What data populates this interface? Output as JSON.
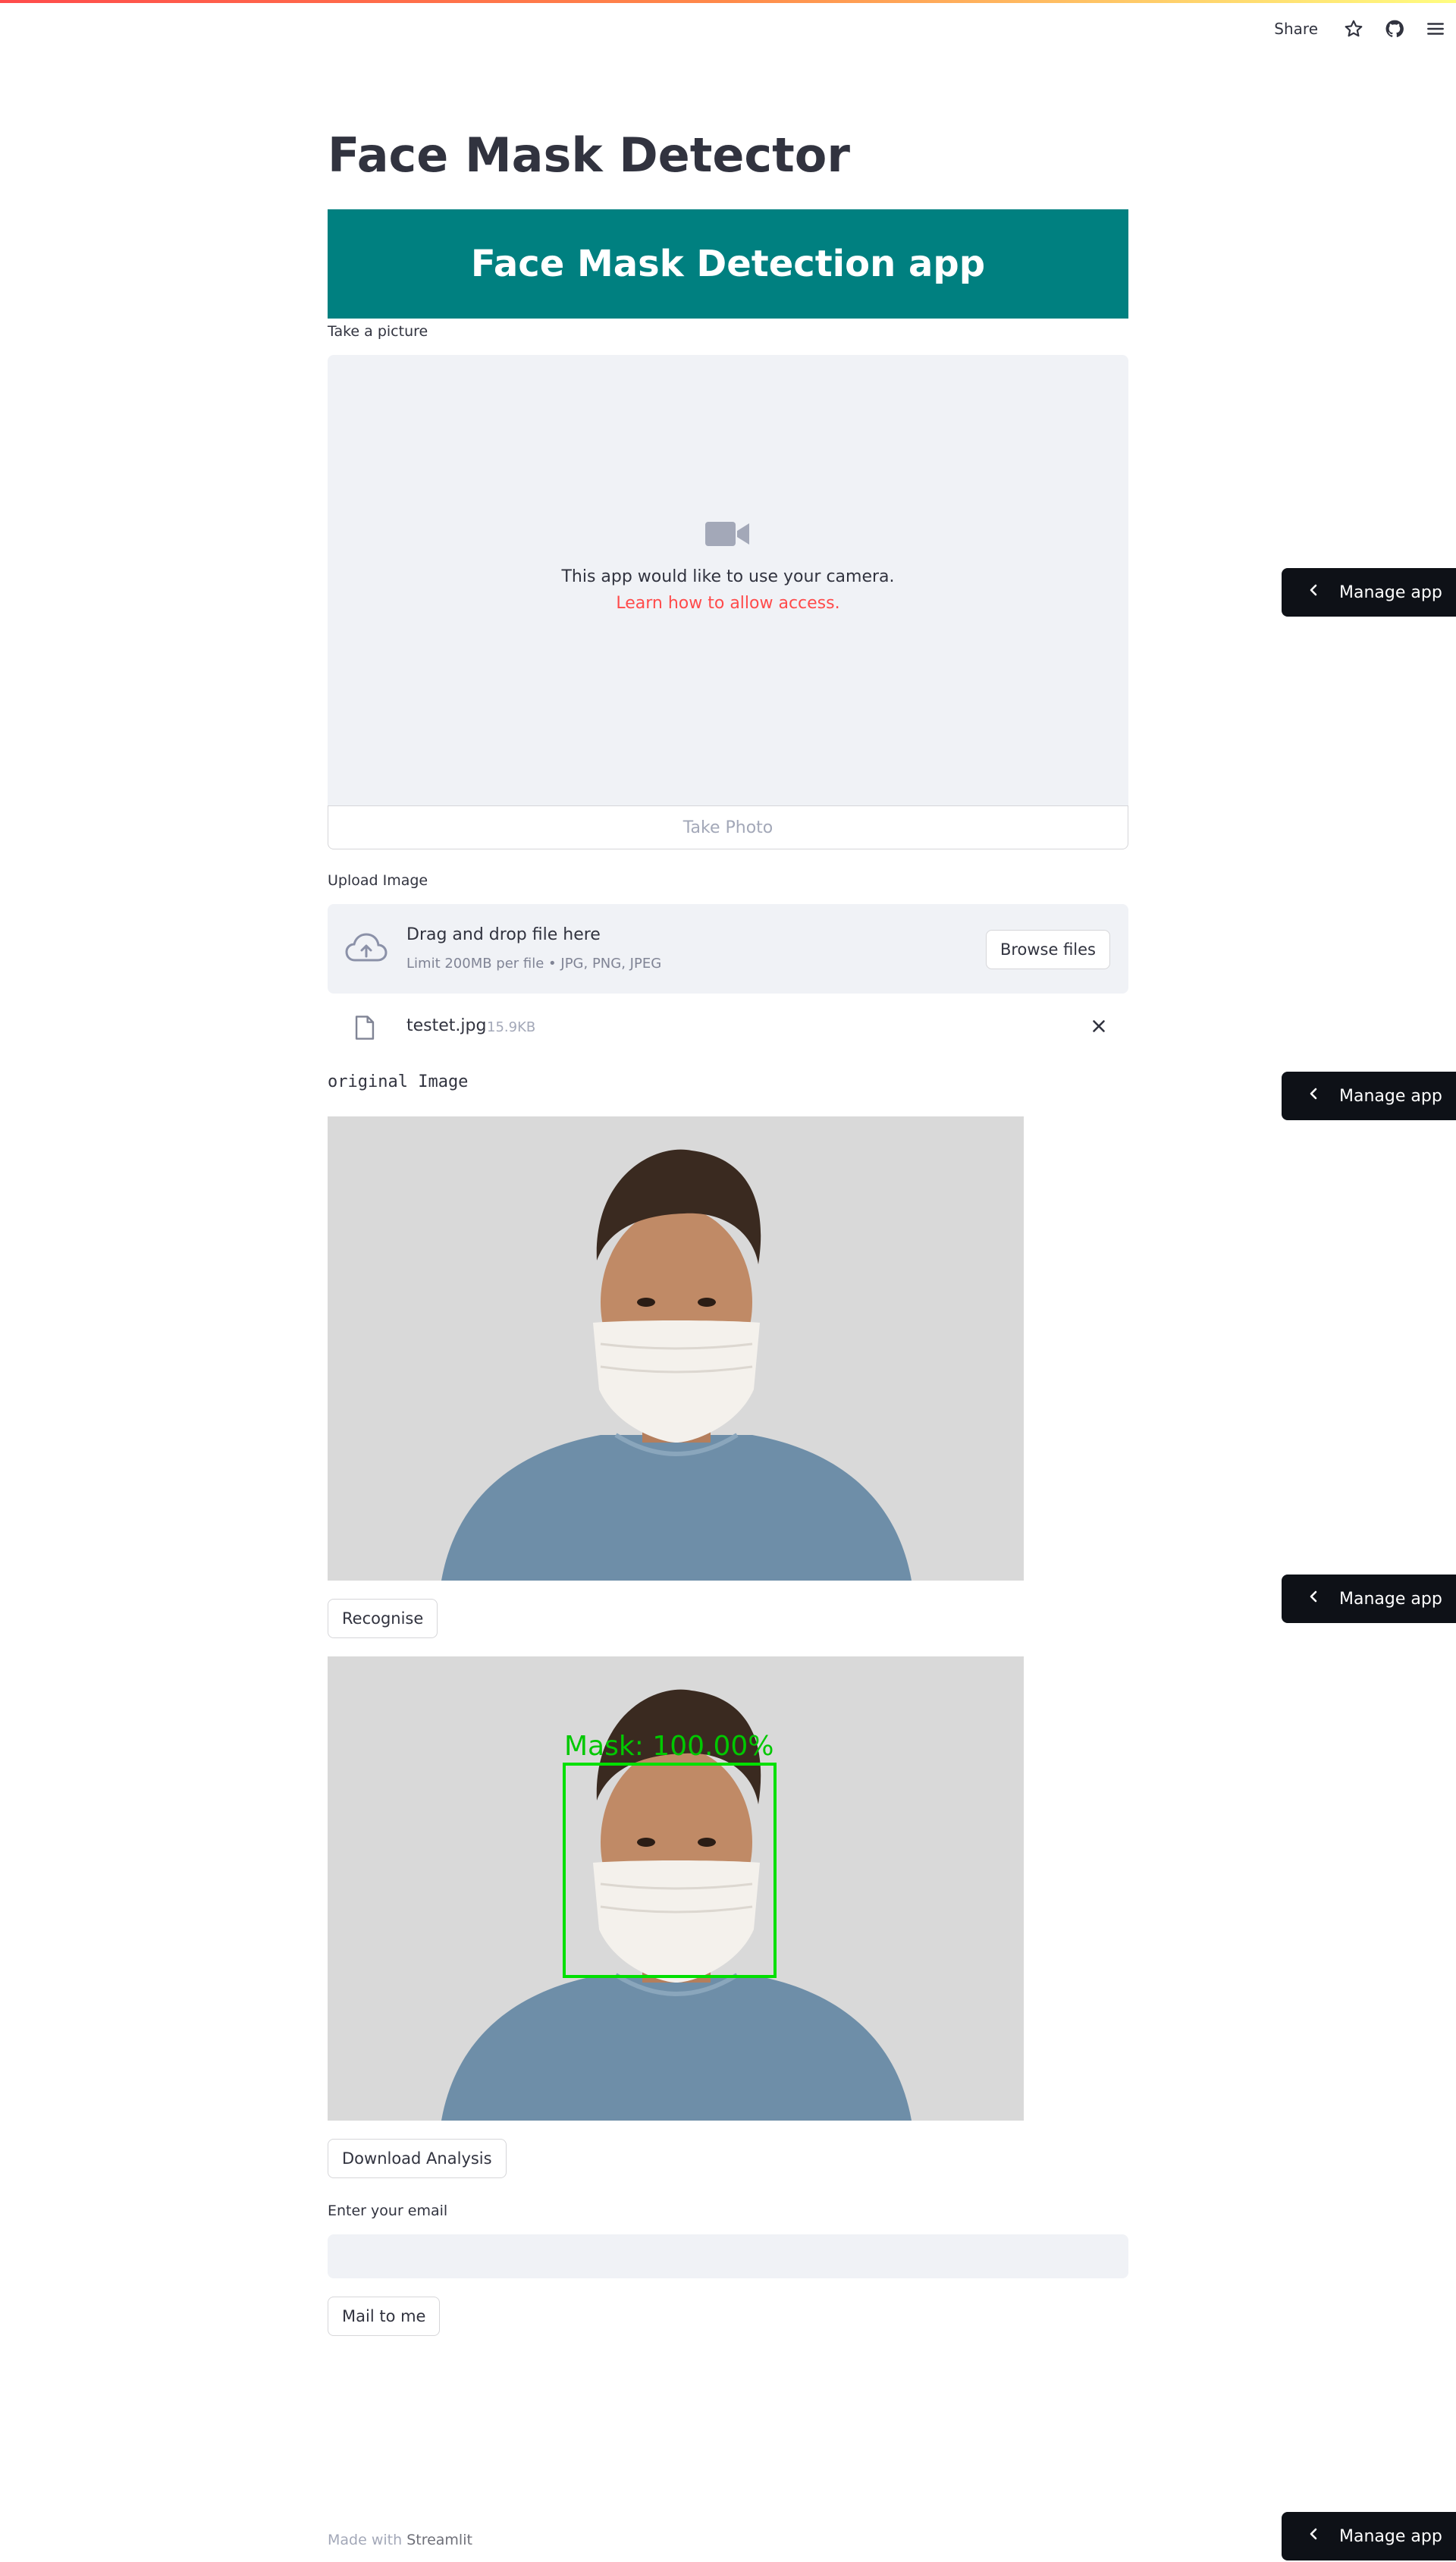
{
  "header": {
    "share_label": "Share",
    "icons": [
      "star-icon",
      "github-icon",
      "hamburger-menu-icon"
    ]
  },
  "page": {
    "title": "Face Mask Detector",
    "banner": "Face Mask Detection app"
  },
  "camera": {
    "label": "Take a picture",
    "icon": "video-camera-icon",
    "message": "This app would like to use your camera.",
    "link": "Learn how to allow access.",
    "button": "Take Photo"
  },
  "upload": {
    "label": "Upload Image",
    "icon": "cloud-upload-icon",
    "drop_text": "Drag and drop file here",
    "limit_text": "Limit 200MB per file • JPG, PNG, JPEG",
    "browse_button": "Browse files",
    "file": {
      "name": "testet.jpg",
      "size": "15.9KB"
    }
  },
  "original": {
    "label": "original Image"
  },
  "recognise_button": "Recognise",
  "result": {
    "detection_label": "Mask: 100.00%",
    "box_color": "#00e000"
  },
  "download_button": "Download Analysis",
  "email": {
    "label": "Enter your email",
    "value": "",
    "placeholder": ""
  },
  "mail_button": "Mail to me",
  "footer": {
    "prefix": "Made with",
    "brand": "Streamlit"
  },
  "manage_app": {
    "label": "Manage app"
  },
  "colors": {
    "accent": "#ff4b4b",
    "banner": "#008080",
    "manage_bg": "#0e1117"
  }
}
